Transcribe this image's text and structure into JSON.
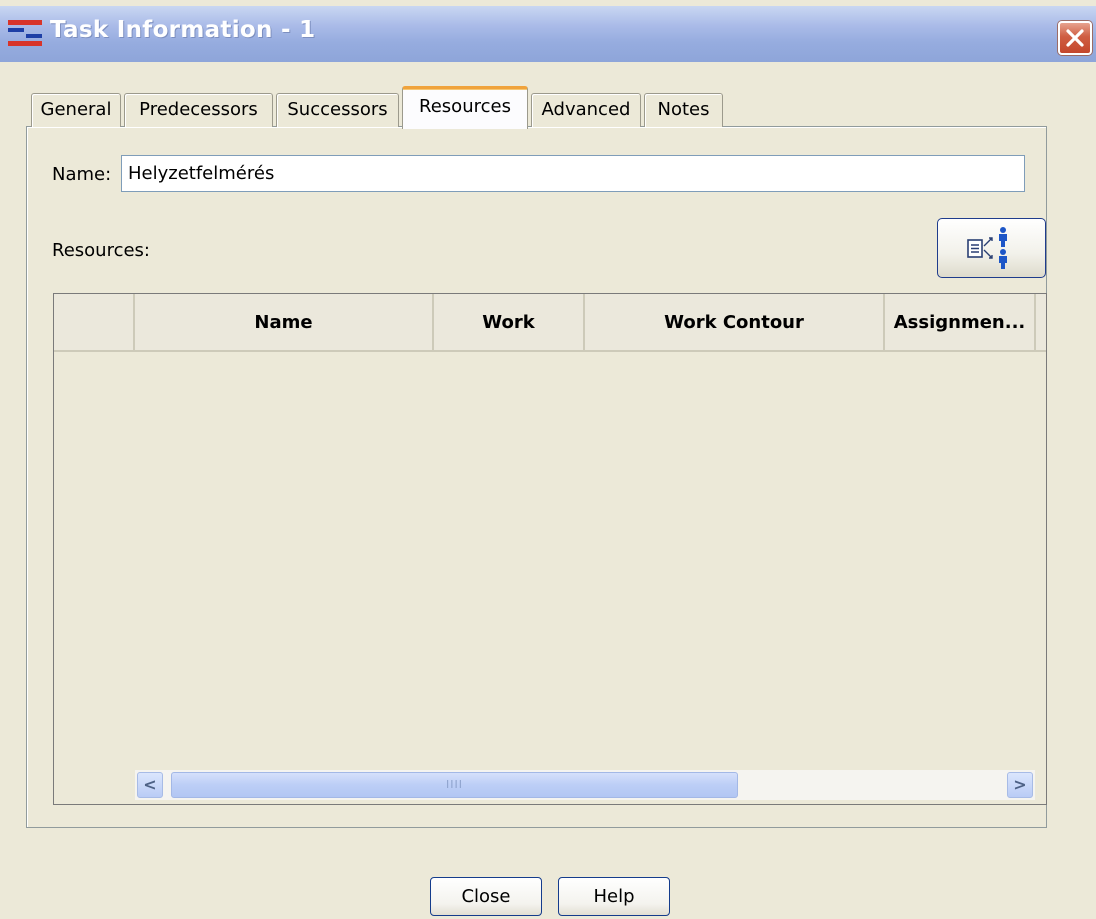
{
  "window": {
    "title": "Task Information - 1",
    "icons": {
      "app": "gantt-app-icon",
      "close": "close-icon"
    }
  },
  "tabs": [
    {
      "label": "General",
      "active": false
    },
    {
      "label": "Predecessors",
      "active": false
    },
    {
      "label": "Successors",
      "active": false
    },
    {
      "label": "Resources",
      "active": true
    },
    {
      "label": "Advanced",
      "active": false
    },
    {
      "label": "Notes",
      "active": false
    }
  ],
  "form": {
    "name_label": "Name:",
    "name_value": "Helyzetfelmérés",
    "resources_label": "Resources:",
    "assign_button_icon": "assign-resources-icon"
  },
  "table": {
    "columns": [
      "",
      "Name",
      "Work",
      "Work Contour",
      "Assignmen...",
      ""
    ],
    "rows": []
  },
  "scrollbar": {
    "left_arrow": "<",
    "right_arrow": ">",
    "thumb_grip": "IIII"
  },
  "footer": {
    "close_label": "Close",
    "help_label": "Help"
  },
  "colors": {
    "active_tab_accent": "#f0a33c",
    "title_bar": "#96acdf",
    "close_button": "#cf5e43",
    "background": "#ece9d8"
  }
}
